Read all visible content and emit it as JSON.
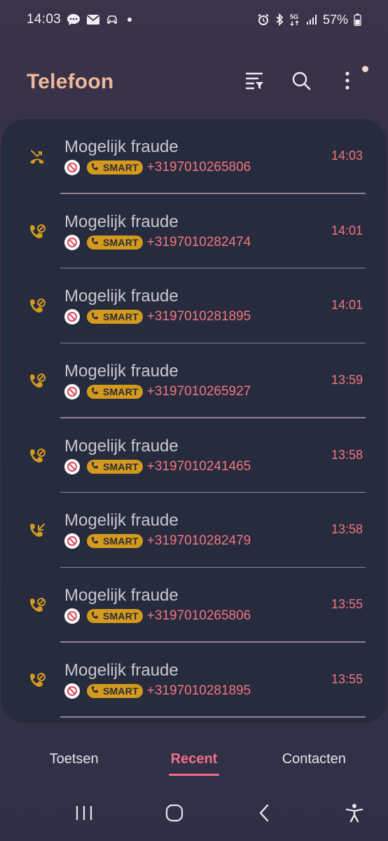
{
  "status": {
    "time": "14:03",
    "network": "5G",
    "battery": "57%",
    "left_icons": [
      "chat-bubble-icon",
      "mail-icon",
      "car-icon",
      "dot-icon"
    ],
    "right_icons": [
      "alarm-icon",
      "bluetooth-icon",
      "5g-icon",
      "signal-icon",
      "battery-icon"
    ]
  },
  "app": {
    "title": "Telefoon",
    "actions": [
      "filter-icon",
      "search-icon",
      "more-vert-icon"
    ]
  },
  "calls": [
    {
      "name": "Mogelijk fraude",
      "smart": "SMART",
      "number": "+3197010265806",
      "time": "14:03",
      "type": "missed"
    },
    {
      "name": "Mogelijk fraude",
      "smart": "SMART",
      "number": "+3197010282474",
      "time": "14:01",
      "type": "blocked"
    },
    {
      "name": "Mogelijk fraude",
      "smart": "SMART",
      "number": "+3197010281895",
      "time": "14:01",
      "type": "blocked"
    },
    {
      "name": "Mogelijk fraude",
      "smart": "SMART",
      "number": "+3197010265927",
      "time": "13:59",
      "type": "blocked"
    },
    {
      "name": "Mogelijk fraude",
      "smart": "SMART",
      "number": "+3197010241465",
      "time": "13:58",
      "type": "blocked"
    },
    {
      "name": "Mogelijk fraude",
      "smart": "SMART",
      "number": "+3197010282479",
      "time": "13:58",
      "type": "incoming"
    },
    {
      "name": "Mogelijk fraude",
      "smart": "SMART",
      "number": "+3197010265806",
      "time": "13:55",
      "type": "blocked"
    },
    {
      "name": "Mogelijk fraude",
      "smart": "SMART",
      "number": "+3197010281895",
      "time": "13:55",
      "type": "blocked"
    }
  ],
  "tabs": [
    {
      "label": "Toetsen",
      "active": false
    },
    {
      "label": "Recent",
      "active": true
    },
    {
      "label": "Contacten",
      "active": false
    }
  ],
  "colors": {
    "accent": "#f46f8a",
    "title": "#f0b89a",
    "call_icon": "#d49a1e",
    "number": "#f3757d"
  }
}
